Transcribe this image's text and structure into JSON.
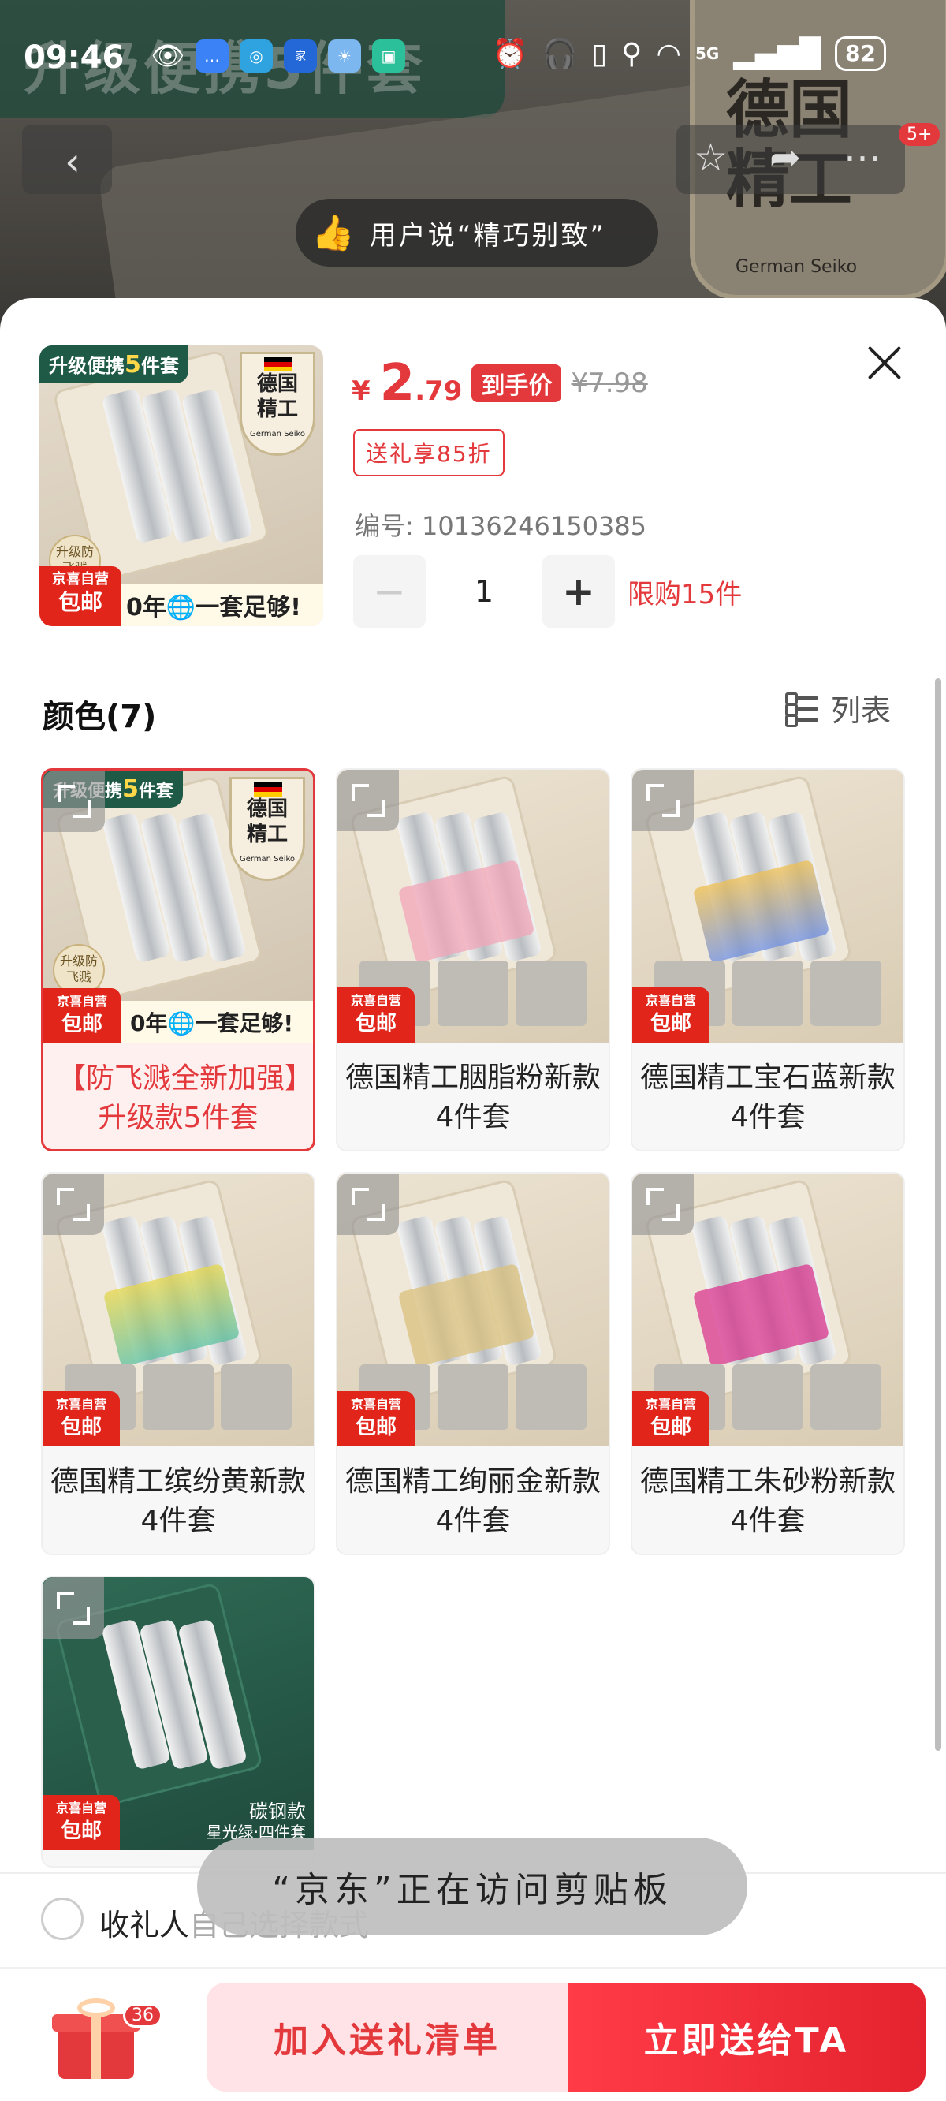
{
  "status_bar": {
    "time": "09:46",
    "network": "5G",
    "battery": "82",
    "icons": [
      "eye-icon",
      "message-icon",
      "mobile-carrier-icon",
      "smart-home-icon",
      "weather-icon",
      "mi-home-icon",
      "alarm-icon",
      "headphones-icon",
      "phone-battery-icon",
      "location-icon",
      "wifi-icon",
      "signal-icon"
    ]
  },
  "background_page": {
    "banner_text": "升级便携5件套",
    "brand_title": "德国精工",
    "brand_sub": "German Seiko",
    "cart_badge": "5+",
    "user_tip": "用户说“精巧别致”"
  },
  "product": {
    "thumb_banner_prefix": "升级便携",
    "thumb_banner_num": "5",
    "thumb_banner_suffix": "件套",
    "thumb_brand": "德国精工",
    "thumb_brand_sub": "German Seiko",
    "thumb_upgrade_tag": "升级防飞溅",
    "thumb_bottom_text": "0年🌐一套足够!",
    "jd_badge_top": "京喜自营",
    "jd_badge_bottom": "包邮",
    "price_symbol": "¥",
    "price_integer": "2",
    "price_decimal": ".79",
    "price_tag": "到手价",
    "price_original": "¥7.98",
    "gift_discount": "送礼享85折",
    "sku_label": "编号: ",
    "sku": "10136246150385",
    "quantity": "1",
    "limit_text": "限购15件"
  },
  "color_section": {
    "title": "颜色(7)",
    "view_toggle": "列表",
    "options": [
      {
        "name": "【防飞溅全新加强】升级款5件套",
        "selected": true,
        "tint": ""
      },
      {
        "name": "德国精工胭脂粉新款4件套",
        "selected": false,
        "tint": "#f2a6b8"
      },
      {
        "name": "德国精工宝石蓝新款4件套",
        "selected": false,
        "tint": "#6f8fe0"
      },
      {
        "name": "德国精工缤纷黄新款4件套",
        "selected": false,
        "tint": "#e8d84a"
      },
      {
        "name": "德国精工绚丽金新款4件套",
        "selected": false,
        "tint": "#d9c07c"
      },
      {
        "name": "德国精工朱砂粉新款4件套",
        "selected": false,
        "tint": "#d9358f"
      },
      {
        "name": "",
        "selected": false,
        "tint": "",
        "image_label_1": "碳钢款",
        "image_label_2": "星光绿·四件套"
      }
    ]
  },
  "recipient": {
    "label": "收礼人",
    "sub": "自己选择款式"
  },
  "action_bar": {
    "gift_count": "36",
    "add_label": "加入送礼清单",
    "send_label": "立即送给TA"
  },
  "toast": "“京东”正在访问剪贴板"
}
